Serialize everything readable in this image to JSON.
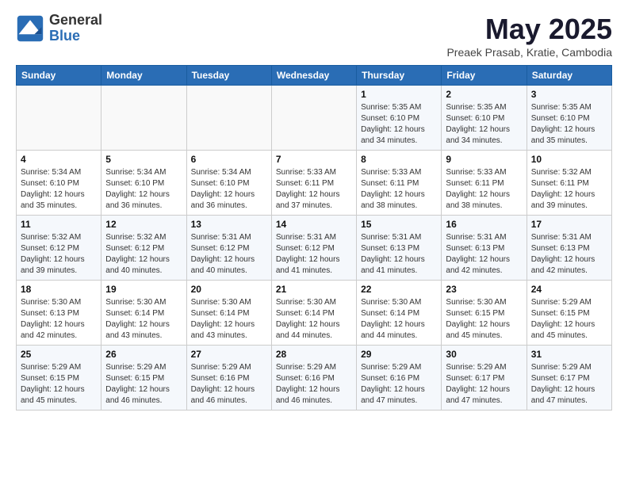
{
  "header": {
    "logo_general": "General",
    "logo_blue": "Blue",
    "month_title": "May 2025",
    "subtitle": "Preaek Prasab, Kratie, Cambodia"
  },
  "days_of_week": [
    "Sunday",
    "Monday",
    "Tuesday",
    "Wednesday",
    "Thursday",
    "Friday",
    "Saturday"
  ],
  "weeks": [
    [
      {
        "day": "",
        "info": ""
      },
      {
        "day": "",
        "info": ""
      },
      {
        "day": "",
        "info": ""
      },
      {
        "day": "",
        "info": ""
      },
      {
        "day": "1",
        "info": "Sunrise: 5:35 AM\nSunset: 6:10 PM\nDaylight: 12 hours\nand 34 minutes."
      },
      {
        "day": "2",
        "info": "Sunrise: 5:35 AM\nSunset: 6:10 PM\nDaylight: 12 hours\nand 34 minutes."
      },
      {
        "day": "3",
        "info": "Sunrise: 5:35 AM\nSunset: 6:10 PM\nDaylight: 12 hours\nand 35 minutes."
      }
    ],
    [
      {
        "day": "4",
        "info": "Sunrise: 5:34 AM\nSunset: 6:10 PM\nDaylight: 12 hours\nand 35 minutes."
      },
      {
        "day": "5",
        "info": "Sunrise: 5:34 AM\nSunset: 6:10 PM\nDaylight: 12 hours\nand 36 minutes."
      },
      {
        "day": "6",
        "info": "Sunrise: 5:34 AM\nSunset: 6:10 PM\nDaylight: 12 hours\nand 36 minutes."
      },
      {
        "day": "7",
        "info": "Sunrise: 5:33 AM\nSunset: 6:11 PM\nDaylight: 12 hours\nand 37 minutes."
      },
      {
        "day": "8",
        "info": "Sunrise: 5:33 AM\nSunset: 6:11 PM\nDaylight: 12 hours\nand 38 minutes."
      },
      {
        "day": "9",
        "info": "Sunrise: 5:33 AM\nSunset: 6:11 PM\nDaylight: 12 hours\nand 38 minutes."
      },
      {
        "day": "10",
        "info": "Sunrise: 5:32 AM\nSunset: 6:11 PM\nDaylight: 12 hours\nand 39 minutes."
      }
    ],
    [
      {
        "day": "11",
        "info": "Sunrise: 5:32 AM\nSunset: 6:12 PM\nDaylight: 12 hours\nand 39 minutes."
      },
      {
        "day": "12",
        "info": "Sunrise: 5:32 AM\nSunset: 6:12 PM\nDaylight: 12 hours\nand 40 minutes."
      },
      {
        "day": "13",
        "info": "Sunrise: 5:31 AM\nSunset: 6:12 PM\nDaylight: 12 hours\nand 40 minutes."
      },
      {
        "day": "14",
        "info": "Sunrise: 5:31 AM\nSunset: 6:12 PM\nDaylight: 12 hours\nand 41 minutes."
      },
      {
        "day": "15",
        "info": "Sunrise: 5:31 AM\nSunset: 6:13 PM\nDaylight: 12 hours\nand 41 minutes."
      },
      {
        "day": "16",
        "info": "Sunrise: 5:31 AM\nSunset: 6:13 PM\nDaylight: 12 hours\nand 42 minutes."
      },
      {
        "day": "17",
        "info": "Sunrise: 5:31 AM\nSunset: 6:13 PM\nDaylight: 12 hours\nand 42 minutes."
      }
    ],
    [
      {
        "day": "18",
        "info": "Sunrise: 5:30 AM\nSunset: 6:13 PM\nDaylight: 12 hours\nand 42 minutes."
      },
      {
        "day": "19",
        "info": "Sunrise: 5:30 AM\nSunset: 6:14 PM\nDaylight: 12 hours\nand 43 minutes."
      },
      {
        "day": "20",
        "info": "Sunrise: 5:30 AM\nSunset: 6:14 PM\nDaylight: 12 hours\nand 43 minutes."
      },
      {
        "day": "21",
        "info": "Sunrise: 5:30 AM\nSunset: 6:14 PM\nDaylight: 12 hours\nand 44 minutes."
      },
      {
        "day": "22",
        "info": "Sunrise: 5:30 AM\nSunset: 6:14 PM\nDaylight: 12 hours\nand 44 minutes."
      },
      {
        "day": "23",
        "info": "Sunrise: 5:30 AM\nSunset: 6:15 PM\nDaylight: 12 hours\nand 45 minutes."
      },
      {
        "day": "24",
        "info": "Sunrise: 5:29 AM\nSunset: 6:15 PM\nDaylight: 12 hours\nand 45 minutes."
      }
    ],
    [
      {
        "day": "25",
        "info": "Sunrise: 5:29 AM\nSunset: 6:15 PM\nDaylight: 12 hours\nand 45 minutes."
      },
      {
        "day": "26",
        "info": "Sunrise: 5:29 AM\nSunset: 6:15 PM\nDaylight: 12 hours\nand 46 minutes."
      },
      {
        "day": "27",
        "info": "Sunrise: 5:29 AM\nSunset: 6:16 PM\nDaylight: 12 hours\nand 46 minutes."
      },
      {
        "day": "28",
        "info": "Sunrise: 5:29 AM\nSunset: 6:16 PM\nDaylight: 12 hours\nand 46 minutes."
      },
      {
        "day": "29",
        "info": "Sunrise: 5:29 AM\nSunset: 6:16 PM\nDaylight: 12 hours\nand 47 minutes."
      },
      {
        "day": "30",
        "info": "Sunrise: 5:29 AM\nSunset: 6:17 PM\nDaylight: 12 hours\nand 47 minutes."
      },
      {
        "day": "31",
        "info": "Sunrise: 5:29 AM\nSunset: 6:17 PM\nDaylight: 12 hours\nand 47 minutes."
      }
    ]
  ]
}
